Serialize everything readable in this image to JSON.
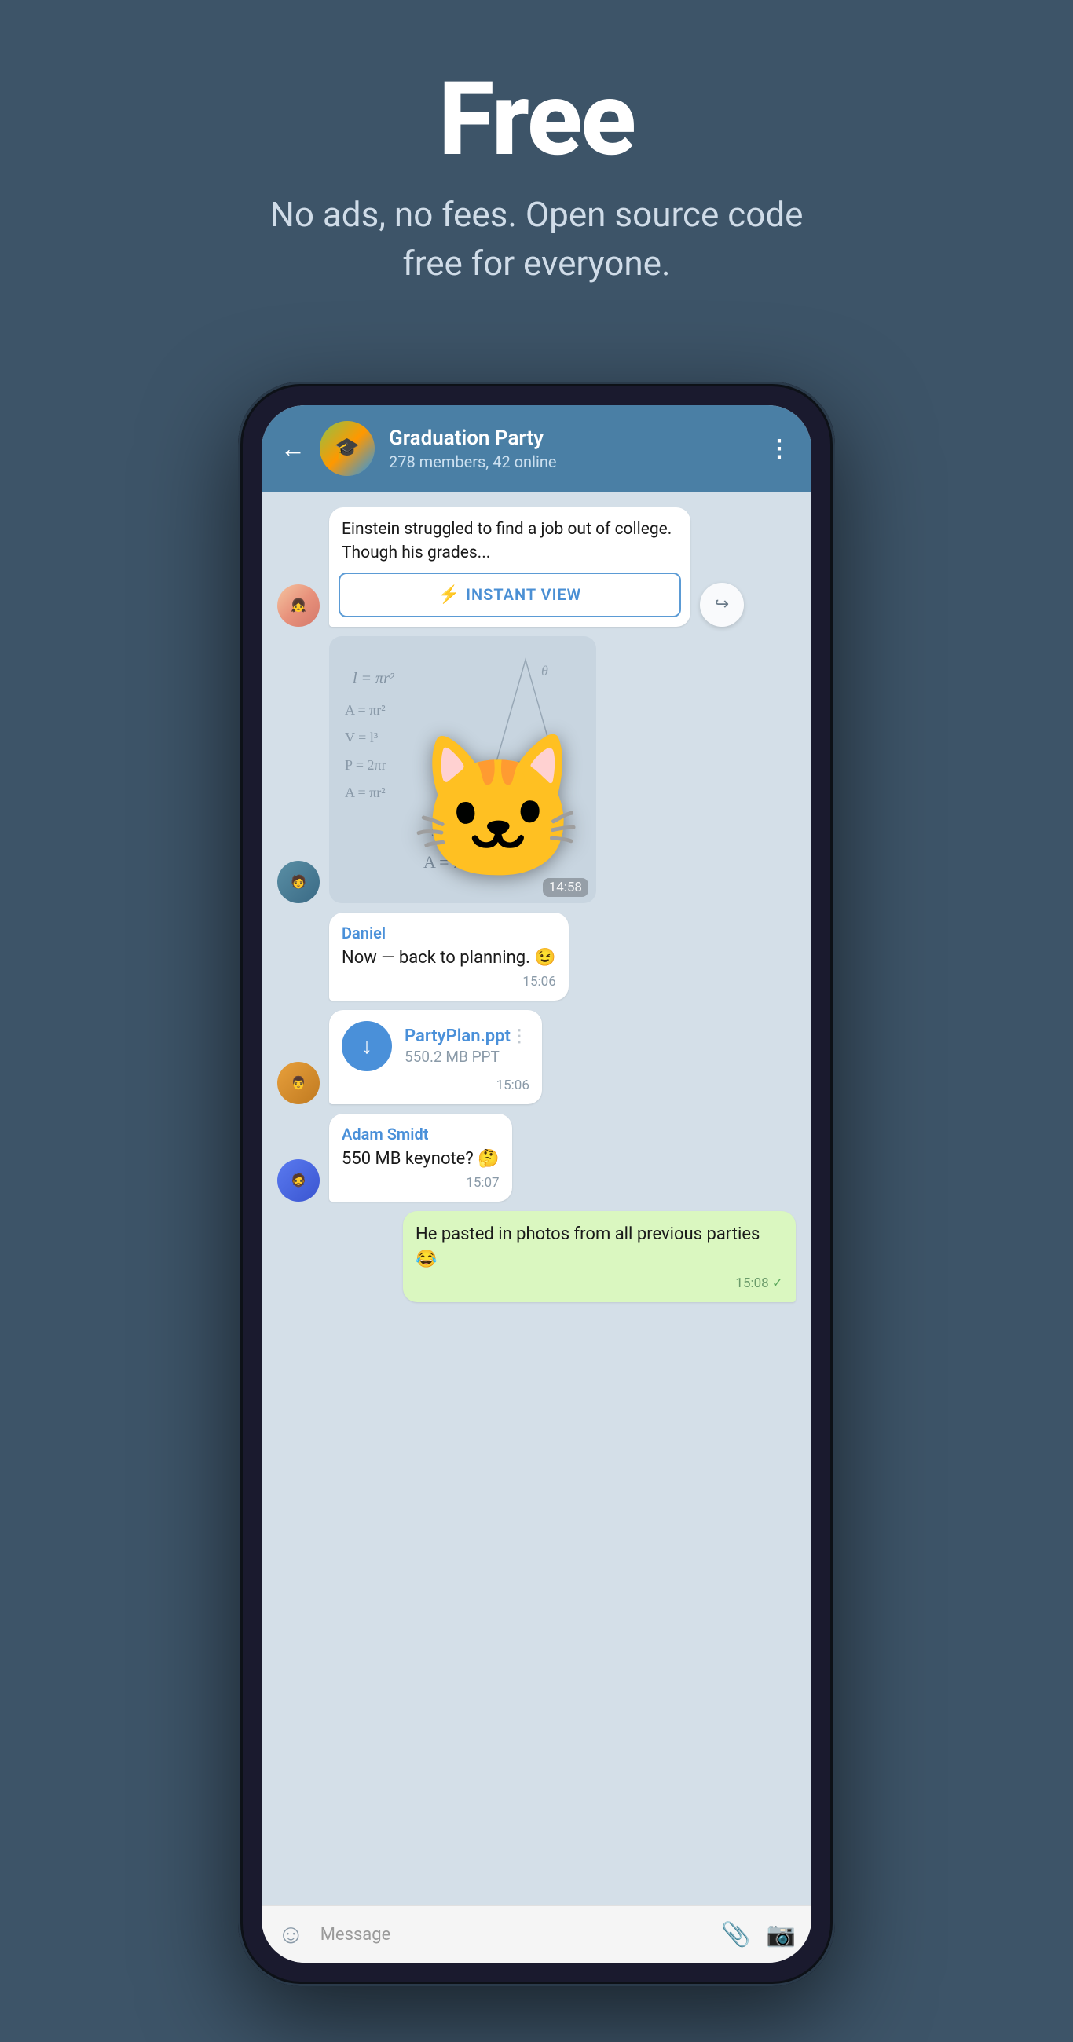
{
  "hero": {
    "title": "Free",
    "subtitle": "No ads, no fees. Open source code free for everyone."
  },
  "phone": {
    "header": {
      "group_name": "Graduation Party",
      "members_info": "278 members, 42 online"
    },
    "messages": [
      {
        "type": "article",
        "snippet": "Einstein struggled to find a job out of college. Though his grades...",
        "instant_view_label": "INSTANT VIEW"
      },
      {
        "type": "sticker",
        "time": "14:58"
      },
      {
        "type": "incoming",
        "sender": "Daniel",
        "text": "Now — back to planning. 😉",
        "time": "15:06"
      },
      {
        "type": "file",
        "filename": "PartyPlan.ppt",
        "filesize": "550.2 MB PPT",
        "time": "15:06"
      },
      {
        "type": "incoming",
        "sender": "Adam Smidt",
        "text": "550 MB keynote? 🤔",
        "time": "15:07"
      },
      {
        "type": "outgoing",
        "text": "He pasted in photos from all previous parties 😂",
        "time": "15:08",
        "check": true
      }
    ],
    "input": {
      "placeholder": "Message"
    }
  },
  "colors": {
    "background": "#3d5468",
    "header_bg": "#4a7fa5",
    "chat_bg": "#d4dfe8",
    "bubble_incoming": "#ffffff",
    "bubble_outgoing": "#daf7c0",
    "accent": "#4a90d9"
  }
}
